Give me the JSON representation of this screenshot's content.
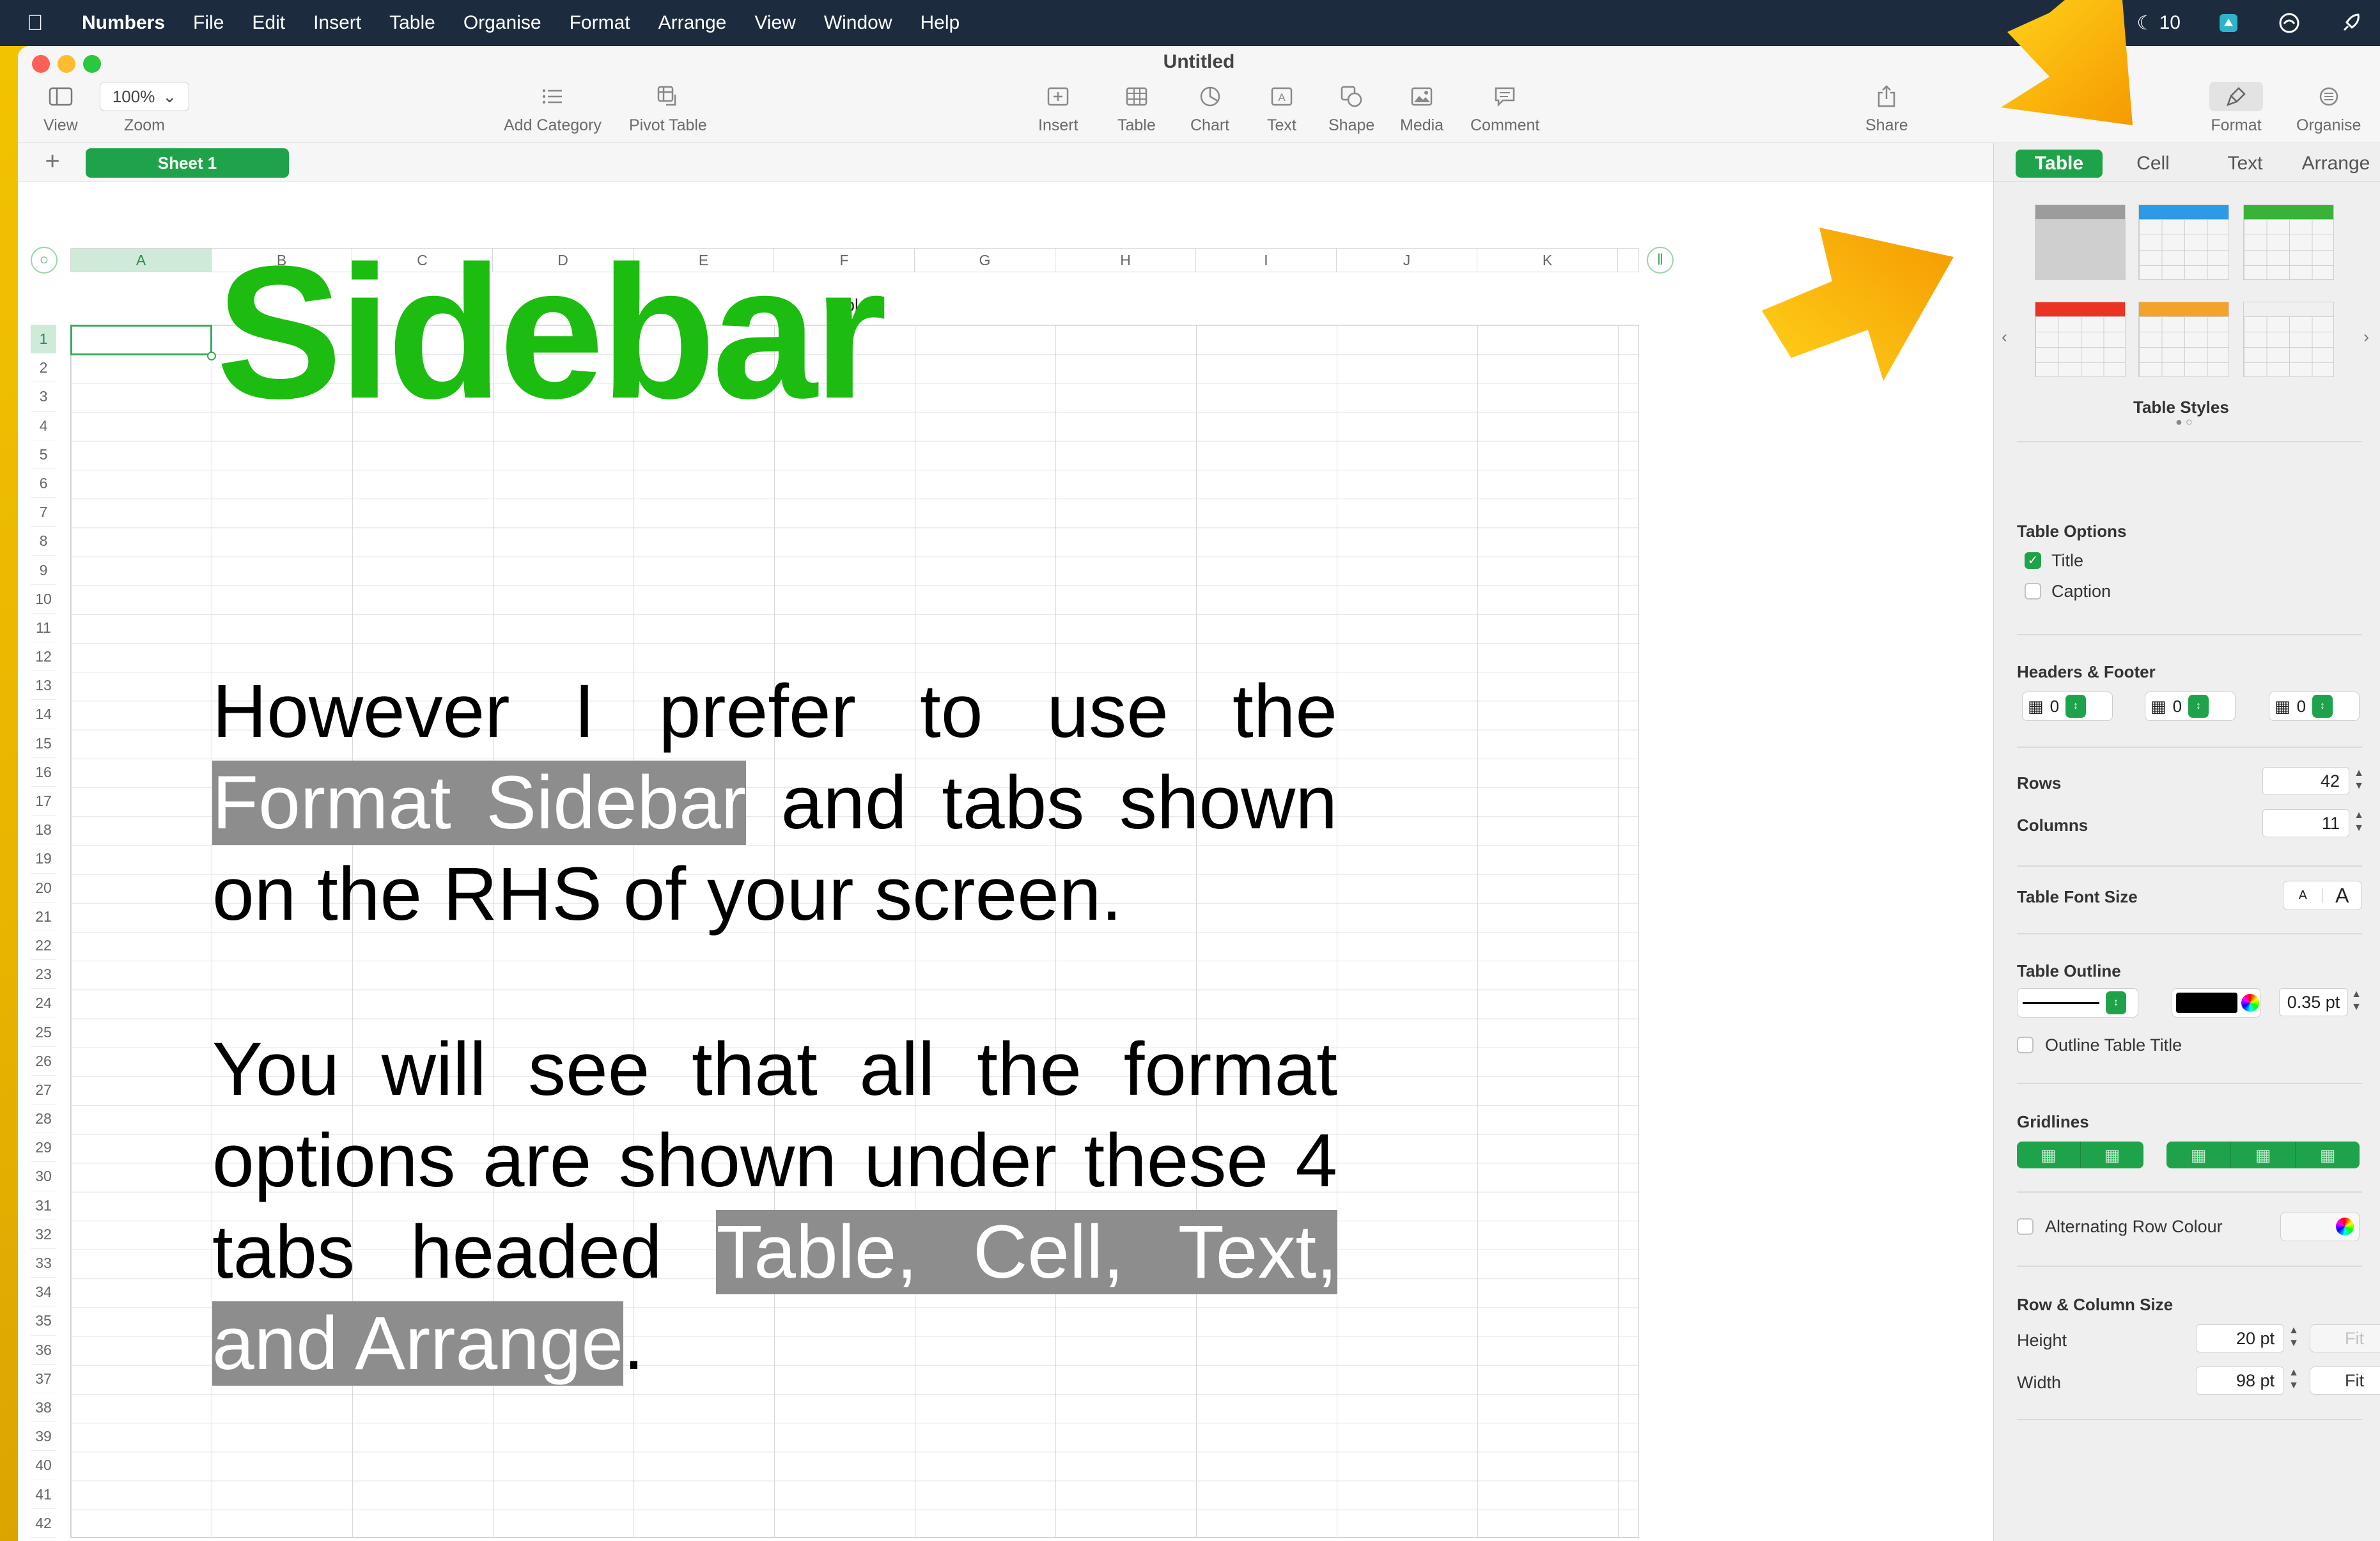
{
  "menubar": {
    "app_name": "Numbers",
    "items": [
      "File",
      "Edit",
      "Insert",
      "Table",
      "Organise",
      "Format",
      "Arrange",
      "View",
      "Window",
      "Help"
    ],
    "status_count": "10"
  },
  "window": {
    "title": "Untitled"
  },
  "toolbar": {
    "view": "View",
    "zoom_value": "100%",
    "zoom": "Zoom",
    "add_category": "Add Category",
    "pivot_table": "Pivot Table",
    "insert": "Insert",
    "table": "Table",
    "chart": "Chart",
    "text": "Text",
    "shape": "Shape",
    "media": "Media",
    "comment": "Comment",
    "share": "Share",
    "format": "Format",
    "organise": "Organise"
  },
  "sheets": {
    "active": "Sheet 1"
  },
  "table": {
    "title": "Table 1",
    "columns": [
      "A",
      "B",
      "C",
      "D",
      "E",
      "F",
      "G",
      "H",
      "I",
      "J",
      "K"
    ],
    "rows": [
      "1",
      "2",
      "3",
      "4",
      "5",
      "6",
      "7",
      "8",
      "9",
      "10",
      "11",
      "12",
      "13",
      "14",
      "15",
      "16",
      "17",
      "18",
      "19",
      "20",
      "21",
      "22",
      "23",
      "24",
      "25",
      "26",
      "27",
      "28",
      "29",
      "30",
      "31",
      "32",
      "33",
      "34",
      "35",
      "36",
      "37",
      "38",
      "39",
      "40",
      "41",
      "42"
    ]
  },
  "overlay": {
    "heading": "Sidebar",
    "p1_a": "However I prefer to use the ",
    "p1_hl": "Format Sidebar",
    "p1_b": " and tabs shown on the RHS of your screen.",
    "p2_a": "You will see that all the format options are shown under these 4 tabs headed ",
    "p2_hl": "Table, Cell, Text, and Arrange",
    "p2_b": "."
  },
  "sidebar": {
    "tabs": [
      "Table",
      "Cell",
      "Text",
      "Arrange"
    ],
    "active_tab": "Table",
    "table_styles_label": "Table Styles",
    "table_options": {
      "title": "Table Options",
      "title_checkbox": "Title",
      "title_checked": true,
      "caption_checkbox": "Caption",
      "caption_checked": false
    },
    "headers_footer": {
      "title": "Headers & Footer",
      "header_rows": "0",
      "header_columns": "0",
      "footer_rows": "0"
    },
    "rows_label": "Rows",
    "rows_value": "42",
    "columns_label": "Columns",
    "columns_value": "11",
    "font_size": {
      "title": "Table Font Size",
      "smaller": "A",
      "larger": "A"
    },
    "outline": {
      "title": "Table Outline",
      "width": "0.35 pt",
      "outline_title_checkbox": "Outline Table Title",
      "color": "#000000"
    },
    "gridlines_title": "Gridlines",
    "alternating_row": "Alternating Row Colour",
    "row_col_size": {
      "title": "Row & Column Size",
      "height_label": "Height",
      "height_value": "20 pt",
      "width_label": "Width",
      "width_value": "98 pt",
      "fit": "Fit"
    }
  },
  "colors": {
    "accent": "#1fa34a",
    "heading_green": "#1cbd10",
    "highlight": "#8d8d8d",
    "arrow": "#f5a800"
  }
}
